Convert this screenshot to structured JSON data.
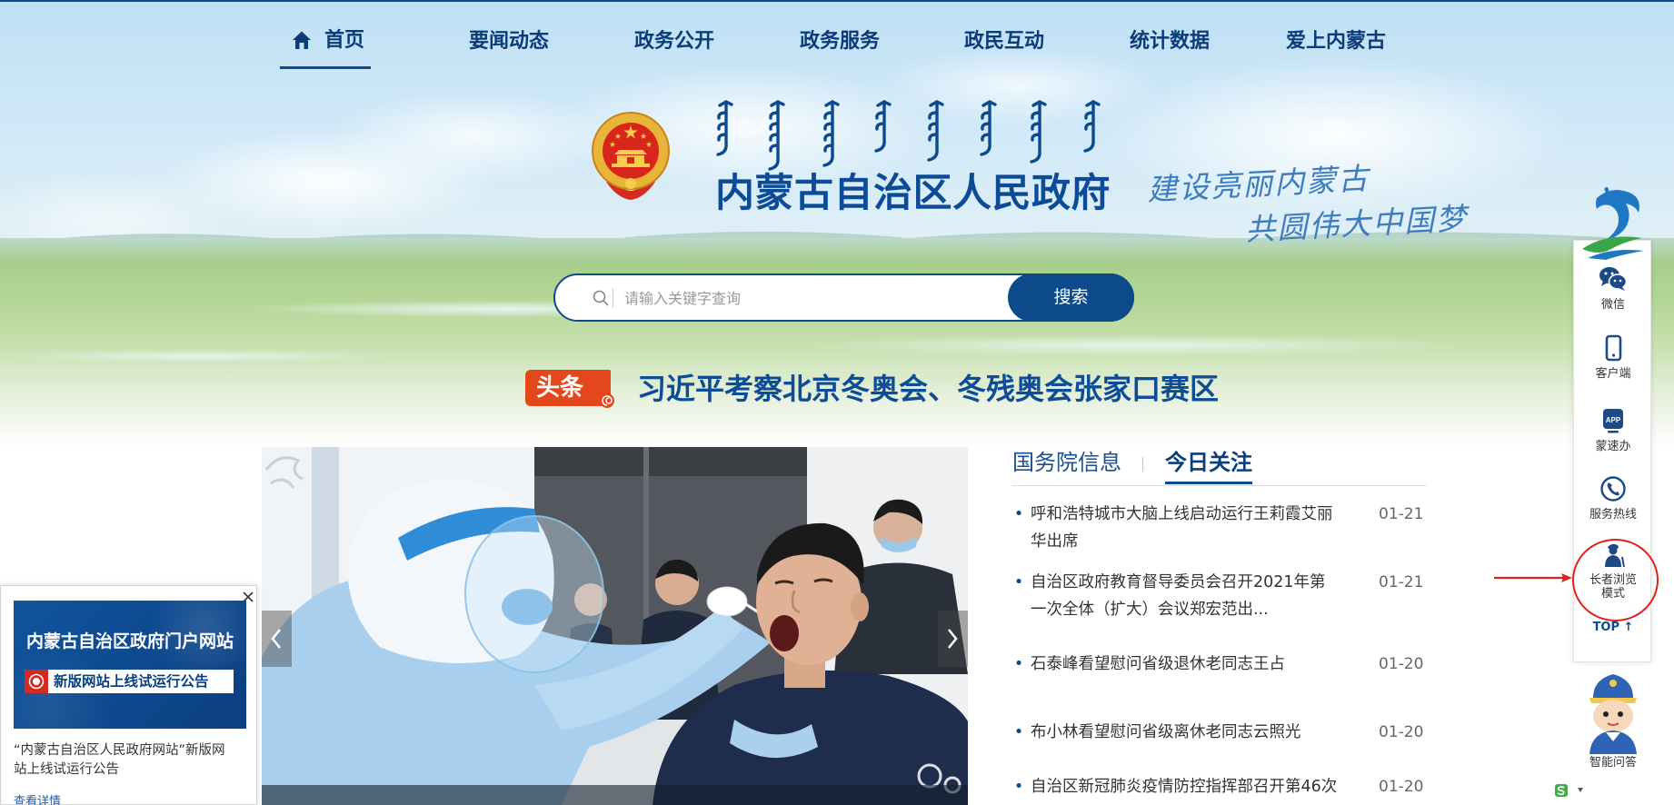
{
  "colors": {
    "primary": "#0c4a8c",
    "nav_text": "#0b3c78",
    "site_title": "#0c4c97",
    "headline_badge": "#e4471c",
    "highlight_ring": "#e0201b"
  },
  "nav": {
    "items": [
      {
        "label": "首页",
        "icon": "home-icon",
        "active": true
      },
      {
        "label": "要闻动态"
      },
      {
        "label": "政务公开"
      },
      {
        "label": "政务服务"
      },
      {
        "label": "政民互动"
      },
      {
        "label": "统计数据"
      },
      {
        "label": "爱上内蒙古"
      }
    ]
  },
  "header": {
    "emblem_icon": "national-emblem-icon",
    "mongolian_title": "ᠥᠪᠥᠷ ᠮᠣᠩᠭᠣᠯ ᠤᠨ ᠥᠪᠡᠷᠲᠡᠭᠡᠨ ᠵᠠᠰᠠᠬᠤ ᠣᠷᠣᠨ ᠤ ᠠᠷᠠᠳ ᠤᠨ ᠵᠠᠰᠠᠭ ᠤᠨ ᠣᠷᠳᠣᠨ",
    "title": "内蒙古自治区人民政府",
    "slogan_line1": "建设亮丽内蒙古",
    "slogan_line2": "共圆伟大中国梦"
  },
  "search": {
    "icon": "search-icon",
    "placeholder": "请输入关键字查询",
    "value": "",
    "button_label": "搜索"
  },
  "headline": {
    "badge": "头条",
    "text": "习近平考察北京冬奥会、冬残奥会张家口赛区"
  },
  "slider": {
    "prev_icon": "chevron-left-icon",
    "next_icon": "chevron-right-icon"
  },
  "news": {
    "tabs": [
      {
        "label": "国务院信息",
        "active": false
      },
      {
        "label": "今日关注",
        "active": true
      }
    ],
    "items": [
      {
        "title": "呼和浩特城市大脑上线启动运行王莉霞艾丽华出席",
        "date": "01-21"
      },
      {
        "title": "自治区政府教育督导委员会召开2021年第一次全体（扩大）会议郑宏范出...",
        "date": "01-21"
      },
      {
        "title": "石泰峰看望慰问省级退休老同志王占",
        "date": "01-20"
      },
      {
        "title": "布小林看望慰问省级离休老同志云照光",
        "date": "01-20"
      },
      {
        "title": "自治区新冠肺炎疫情防控指挥部召开第46次",
        "date": "01-20"
      }
    ]
  },
  "popup": {
    "close_icon": "close-icon",
    "banner_title": "内蒙古自治区政府门户网站",
    "banner_notice": "新版网站上线试运行公告",
    "description": "“内蒙古自治区人民政府网站”新版网站上线试运行公告",
    "link": "查看详情"
  },
  "sidebar": {
    "logo_icon": "horse-logo-icon",
    "items": [
      {
        "label": "微信",
        "icon": "wechat-icon"
      },
      {
        "label": "客户端",
        "icon": "mobile-icon"
      },
      {
        "label": "蒙速办",
        "icon": "app-icon",
        "icon_text": "APP"
      },
      {
        "label": "服务热线",
        "icon": "hotline-icon"
      },
      {
        "label": "长者浏览模式",
        "icon": "elderly-mode-icon",
        "highlighted": true
      }
    ],
    "top_label": "TOP ↑",
    "assistant": {
      "label": "智能问答",
      "icon": "robot-assistant-icon"
    }
  }
}
